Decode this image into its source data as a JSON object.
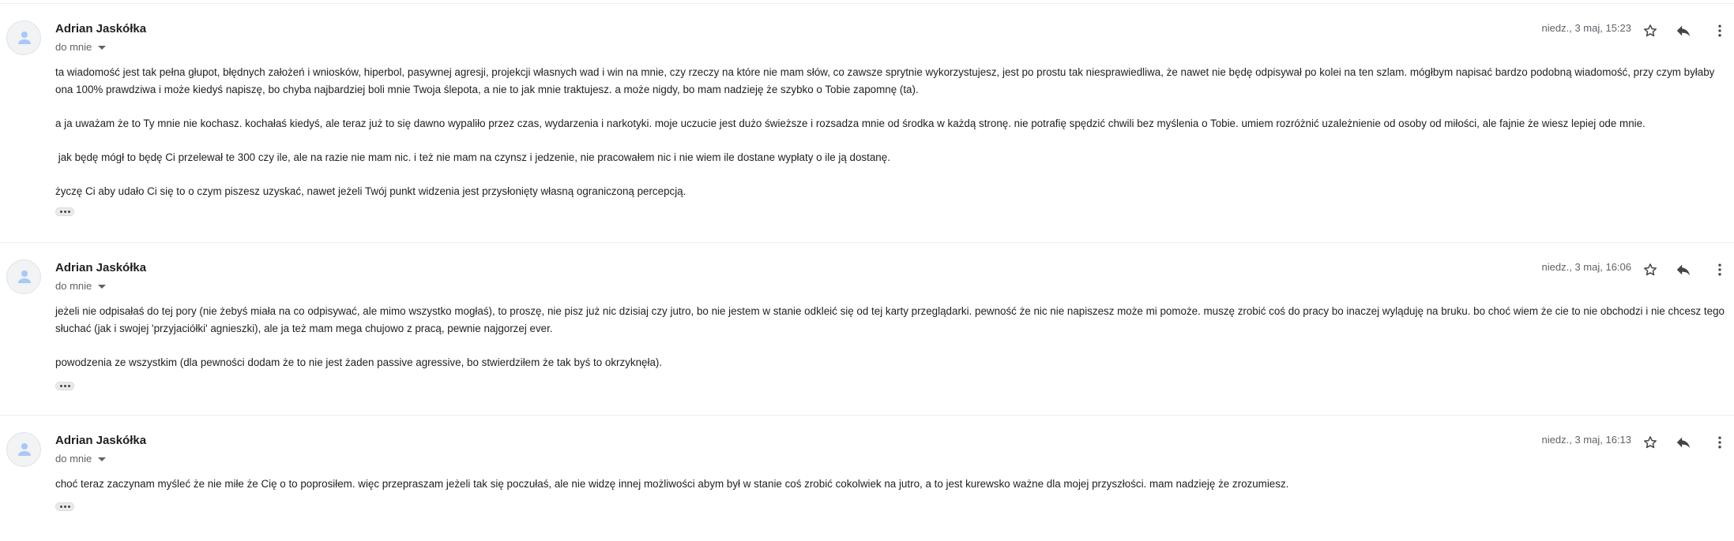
{
  "messages": [
    {
      "sender": "Adrian Jaskółka",
      "to_label": "do mnie",
      "date": "niedz., 3 maj, 15:23",
      "paragraphs": [
        "ta wiadomość jest tak pełna głupot, błędnych założeń i wniosków, hiperbol, pasywnej agresji, projekcji własnych wad i win na mnie, czy rzeczy na które nie mam słów, co zawsze sprytnie wykorzystujesz, jest po prostu tak niesprawiedliwa, że nawet nie będę odpisywał po kolei na ten szlam. mógłbym napisać bardzo podobną wiadomość, przy czym byłaby ona 100% prawdziwa i może kiedyś napiszę, bo chyba najbardziej boli mnie Twoja ślepota, a nie to jak mnie traktujesz. a może nigdy, bo mam nadzieję że szybko o Tobie zapomnę (ta).",
        "a ja uważam że to Ty mnie nie kochasz. kochałaś kiedyś, ale teraz już to się dawno wypaliło przez czas, wydarzenia i narkotyki. moje uczucie jest dużo świeższe i rozsadza mnie od środka w każdą stronę. nie potrafię spędzić chwili bez myślenia o Tobie. umiem rozróżnić uzależnienie od osoby od miłości, ale fajnie że wiesz lepiej ode mnie.",
        " jak będę mógł to będę Ci przelewał te 300 czy ile, ale na razie nie mam nic. i też nie mam na czynsz i jedzenie, nie pracowałem nic i nie wiem ile dostane wypłaty o ile ją dostanę.",
        "życzę Ci aby udało Ci się to o czym piszesz uzyskać, nawet jeżeli Twój punkt widzenia jest przysłonięty własną ograniczoną percepcją."
      ]
    },
    {
      "sender": "Adrian Jaskółka",
      "to_label": "do mnie",
      "date": "niedz., 3 maj, 16:06",
      "paragraphs": [
        "jeżeli nie odpisałaś do tej pory (nie żebyś miała na co odpisywać, ale mimo wszystko mogłaś), to proszę, nie pisz już nic dzisiaj czy jutro, bo nie jestem w stanie odkleić się od tej karty przeglądarki. pewność że nic nie napiszesz może mi pomoże. muszę zrobić coś do pracy bo inaczej wyląduję na bruku. bo choć wiem że cie to nie obchodzi i nie chcesz tego słuchać (jak i swojej 'przyjaciółki' agnieszki), ale ja też mam mega chujowo z pracą, pewnie najgorzej ever.",
        "powodzenia ze wszystkim (dla pewności dodam że to nie jest żaden passive agressive, bo stwierdziłem że tak byś to okrzyknęła)."
      ]
    },
    {
      "sender": "Adrian Jaskółka",
      "to_label": "do mnie",
      "date": "niedz., 3 maj, 16:13",
      "paragraphs": [
        "choć teraz zaczynam myśleć że nie miłe że Cię o to poprosiłem. więc przepraszam jeżeli tak się poczułaś, ale nie widzę innej możliwości abym był w stanie coś zrobić cokolwiek na jutro, a to jest kurewsko ważne dla mojej przyszłości. mam nadzieję że zrozumiesz."
      ]
    }
  ],
  "icons": {
    "avatar": "person-icon",
    "star": "star-icon",
    "reply": "reply-icon",
    "more": "more-vert-icon",
    "expand": "ellipsis-icon"
  },
  "colors": {
    "text": "#222222",
    "meta": "#5f6368",
    "divider": "#eceff1",
    "avatar_person": "#a8c7fa"
  }
}
